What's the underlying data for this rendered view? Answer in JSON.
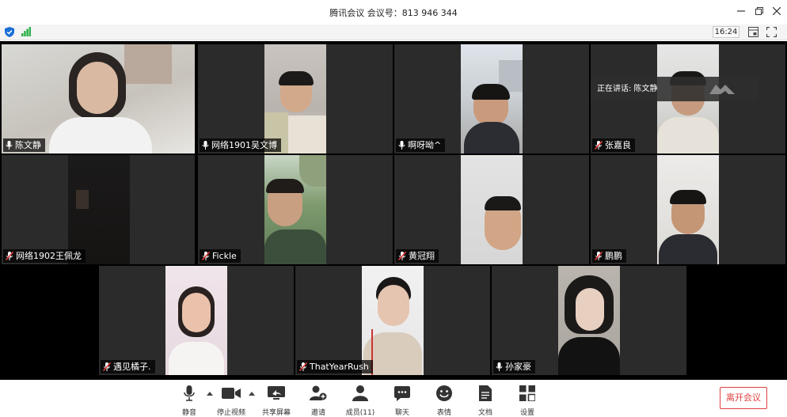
{
  "window": {
    "title": "腾讯会议 会议号：813 946 344"
  },
  "toolbar": {
    "time": "16:24"
  },
  "speaking": {
    "text": "正在讲话: 陈文静"
  },
  "participants": [
    {
      "name": "陈文静",
      "mic": "on"
    },
    {
      "name": "网络1901吴文博",
      "mic": "on"
    },
    {
      "name": "啊呀呦^",
      "mic": "on"
    },
    {
      "name": "张嘉良",
      "mic": "muted"
    },
    {
      "name": "网络1902王佩龙",
      "mic": "muted"
    },
    {
      "name": "Fickle",
      "mic": "muted"
    },
    {
      "name": "黄冠翔",
      "mic": "muted"
    },
    {
      "name": "鹏鹏",
      "mic": "muted"
    },
    {
      "name": "遇见橘子.",
      "mic": "muted"
    },
    {
      "name": "ThatYearRush",
      "mic": "muted"
    },
    {
      "name": "孙家豪",
      "mic": "on"
    }
  ],
  "controls": {
    "mute": "静音",
    "stop_video": "停止视频",
    "share": "共享屏幕",
    "invite": "邀请",
    "members": "成员(11)",
    "chat": "聊天",
    "reactions": "表情",
    "docs": "文档",
    "settings": "设置",
    "leave": "离开会议"
  },
  "colors": {
    "leave_red": "#e04040",
    "signal_green": "#2fb24c",
    "shield_blue": "#1a6fd6",
    "muted_red": "#e23b3b"
  }
}
